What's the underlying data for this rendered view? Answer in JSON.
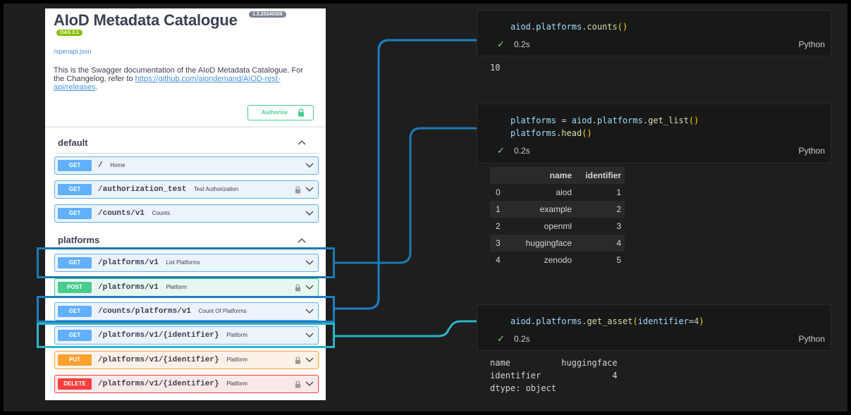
{
  "swagger": {
    "title": "AIoD Metadata Catalogue",
    "version": "1.3.20240308",
    "oas": "OAS 3.1",
    "openapi_link": "/openapi.json",
    "description": "This is the Swagger documentation of the AIoD Metadata Catalogue. For the Changelog, refer to",
    "changelog_link": "https://github.com/aiondemand/AIOD-rest-api/releases",
    "description_end": ".",
    "authorize_label": "Authorize",
    "sections": [
      {
        "name": "default"
      },
      {
        "name": "platforms"
      }
    ],
    "operations": [
      {
        "method": "GET",
        "path": "/",
        "summary": "Home",
        "locked": false
      },
      {
        "method": "GET",
        "path": "/authorization_test",
        "summary": "Test Authorization",
        "locked": true
      },
      {
        "method": "GET",
        "path": "/counts/v1",
        "summary": "Counts",
        "locked": false
      },
      {
        "method": "GET",
        "path": "/platforms/v1",
        "summary": "List Platforms",
        "locked": false
      },
      {
        "method": "POST",
        "path": "/platforms/v1",
        "summary": "Platform",
        "locked": true
      },
      {
        "method": "GET",
        "path": "/counts/platforms/v1",
        "summary": "Count Of Platforms",
        "locked": false
      },
      {
        "method": "GET",
        "path": "/platforms/v1/{identifier}",
        "summary": "Platform",
        "locked": false
      },
      {
        "method": "PUT",
        "path": "/platforms/v1/{identifier}",
        "summary": "Platform",
        "locked": true
      },
      {
        "method": "DELETE",
        "path": "/platforms/v1/{identifier}",
        "summary": "Platform",
        "locked": true
      }
    ]
  },
  "colors": {
    "get": "#61affe",
    "post": "#49cc90",
    "put": "#fca130",
    "delete": "#f93e3e",
    "highlight_blue": "#1d7fc4",
    "highlight_teal": "#2bb5c8"
  },
  "notebook": {
    "cells": [
      {
        "code_lines": [
          "aiod.platforms.counts()"
        ],
        "status": "✓",
        "duration": "0.2s",
        "language": "Python",
        "output": "10"
      },
      {
        "code_lines": [
          "platforms = aiod.platforms.get_list()",
          "platforms.head()"
        ],
        "status": "✓",
        "duration": "0.2s",
        "language": "Python",
        "table": {
          "columns": [
            "",
            "name",
            "identifier"
          ],
          "rows": [
            [
              "0",
              "aiod",
              "1"
            ],
            [
              "1",
              "example",
              "2"
            ],
            [
              "2",
              "openml",
              "3"
            ],
            [
              "3",
              "huggingface",
              "4"
            ],
            [
              "4",
              "zenodo",
              "5"
            ]
          ]
        }
      },
      {
        "code_lines": [
          "aiod.platforms.get_asset(identifier=4)"
        ],
        "status": "✓",
        "duration": "0.2s",
        "language": "Python",
        "output_lines": [
          "name          huggingface",
          "identifier              4",
          "dtype: object"
        ]
      }
    ]
  }
}
